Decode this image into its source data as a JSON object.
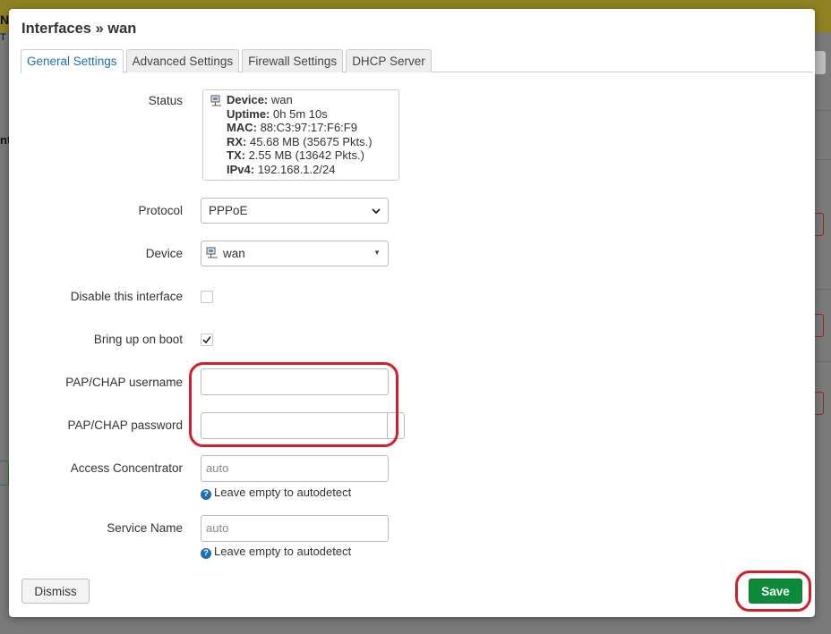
{
  "dialog": {
    "title": "Interfaces » wan",
    "tabs": [
      {
        "label": "General Settings",
        "active": true
      },
      {
        "label": "Advanced Settings",
        "active": false
      },
      {
        "label": "Firewall Settings",
        "active": false
      },
      {
        "label": "DHCP Server",
        "active": false
      }
    ]
  },
  "status": {
    "label": "Status",
    "device_key": "Device:",
    "device_val": "wan",
    "uptime_key": "Uptime:",
    "uptime_val": "0h 5m 10s",
    "mac_key": "MAC:",
    "mac_val": "88:C3:97:17:F6:F9",
    "rx_key": "RX:",
    "rx_val": "45.68 MB (35675 Pkts.)",
    "tx_key": "TX:",
    "tx_val": "2.55 MB (13642 Pkts.)",
    "ipv4_key": "IPv4:",
    "ipv4_val": "192.168.1.2/24"
  },
  "protocol": {
    "label": "Protocol",
    "value": "PPPoE"
  },
  "device": {
    "label": "Device",
    "value": "wan"
  },
  "disable": {
    "label": "Disable this interface",
    "checked": false
  },
  "bring_up": {
    "label": "Bring up on boot",
    "checked": true
  },
  "username": {
    "label": "PAP/CHAP username",
    "value": ""
  },
  "password": {
    "label": "PAP/CHAP password",
    "value": ""
  },
  "access_concentrator": {
    "label": "Access Concentrator",
    "placeholder": "auto",
    "hint": "Leave empty to autodetect"
  },
  "service_name": {
    "label": "Service Name",
    "placeholder": "auto",
    "hint": "Leave empty to autodetect"
  },
  "buttons": {
    "dismiss": "Dismiss",
    "save": "Save"
  },
  "colors": {
    "accent": "#1f6fb0",
    "save": "#0c8a3a",
    "annotation": "#d0202a"
  },
  "background_fragments": {
    "letter_n": "N",
    "letter_t": "T",
    "letter_nt": "nt"
  }
}
